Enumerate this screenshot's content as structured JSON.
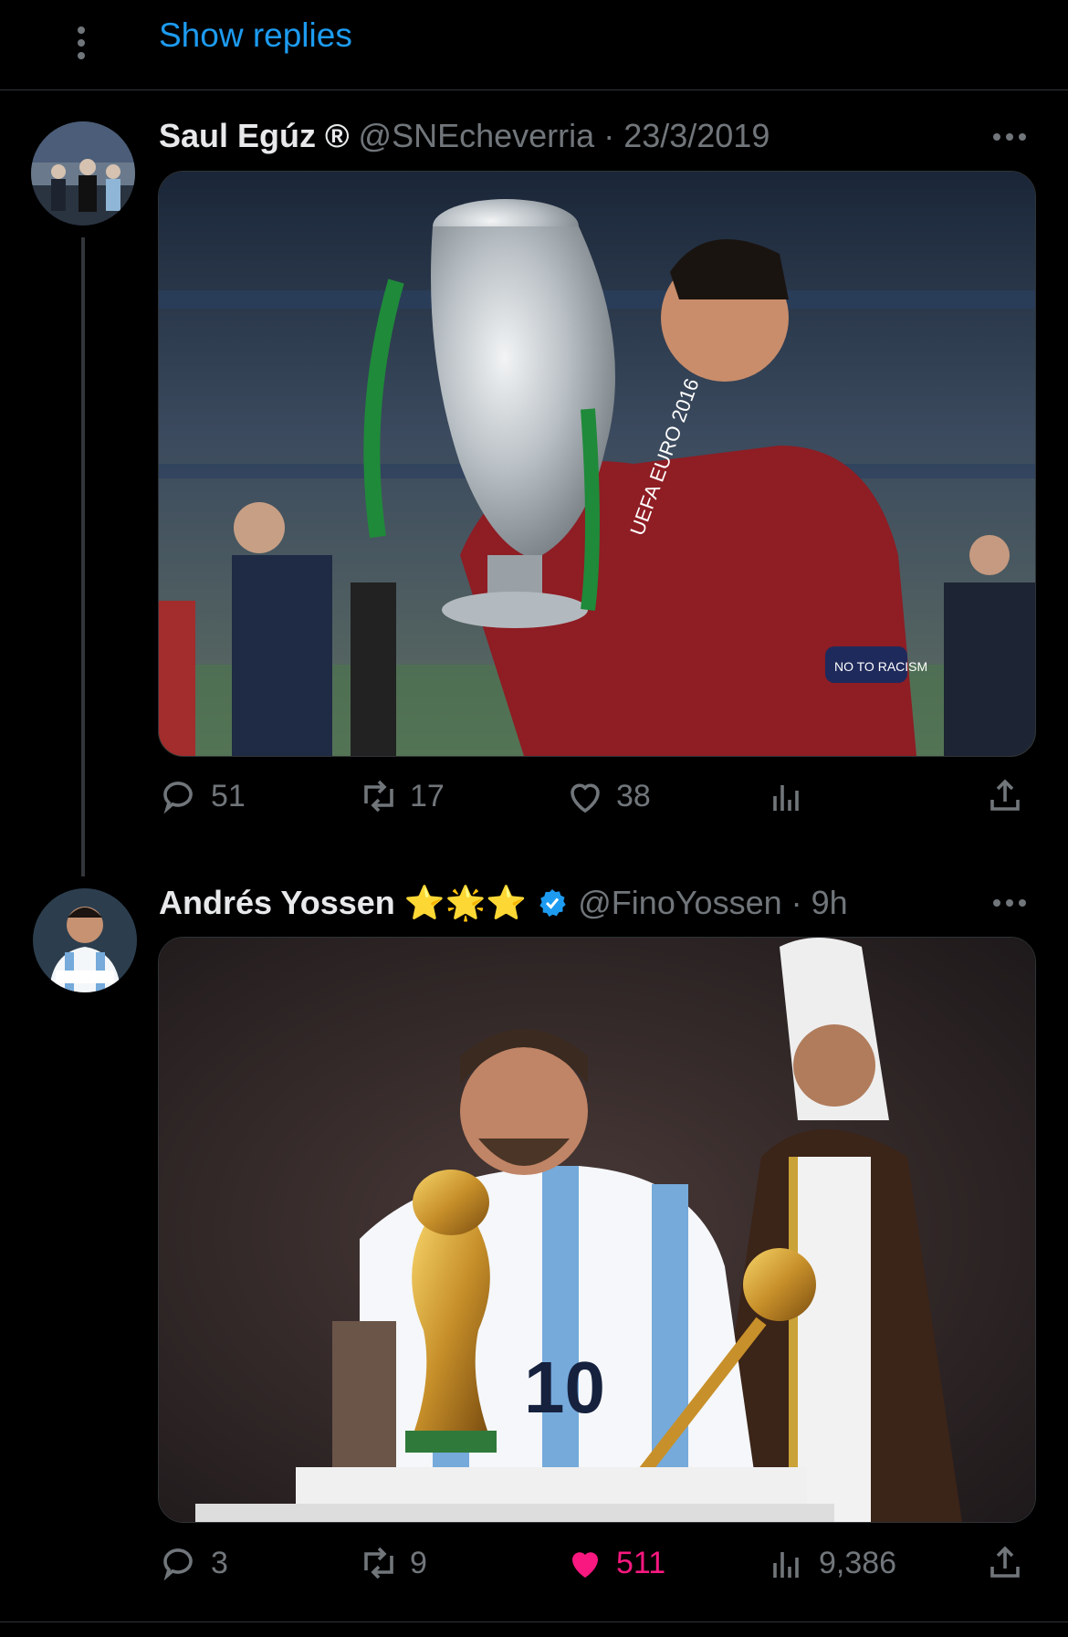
{
  "header": {
    "show_replies": "Show replies"
  },
  "tweets": [
    {
      "name": "Saul Egúz ®",
      "handle": "@SNEcheverria",
      "separator": "·",
      "time": "23/3/2019",
      "media_alt": "UEFA EURO 2016",
      "badge_text": "NO TO RACISM",
      "counts": {
        "replies": "51",
        "retweets": "17",
        "likes": "38",
        "views": ""
      }
    },
    {
      "name": "Andrés Yossen",
      "emoji": "⭐🌟⭐",
      "handle": "@FinoYossen",
      "separator": "·",
      "time": "9h",
      "jersey_number": "10",
      "counts": {
        "replies": "3",
        "retweets": "9",
        "likes": "511",
        "views": "9,386"
      }
    }
  ],
  "colors": {
    "accent": "#1d9bf0",
    "like": "#f91880",
    "muted": "#71767b",
    "background": "#000000"
  },
  "icons": [
    "more-vertical-icon",
    "more-horizontal-icon",
    "reply-icon",
    "retweet-icon",
    "heart-icon",
    "views-icon",
    "share-icon",
    "verified-badge-icon"
  ]
}
